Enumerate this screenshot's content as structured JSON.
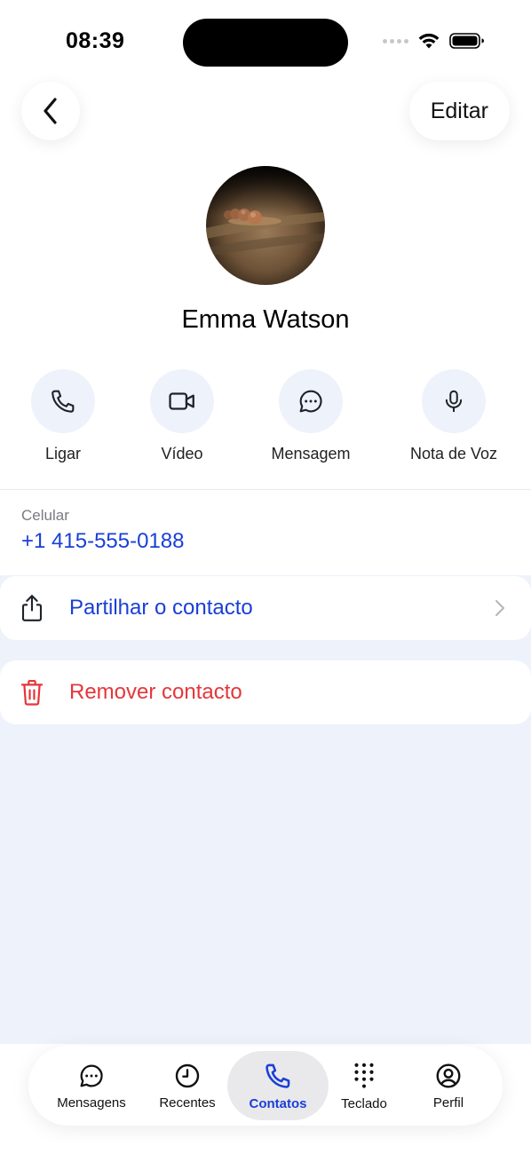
{
  "status_bar": {
    "time": "08:39"
  },
  "header": {
    "back_icon": "chevron-left-icon",
    "edit_label": "Editar"
  },
  "contact": {
    "name": "Emma Watson"
  },
  "actions": [
    {
      "icon": "phone-icon",
      "label": "Ligar"
    },
    {
      "icon": "video-icon",
      "label": "Vídeo"
    },
    {
      "icon": "message-icon",
      "label": "Mensagem"
    },
    {
      "icon": "microphone-icon",
      "label": "Nota de Voz"
    }
  ],
  "phone": {
    "label": "Celular",
    "value": "+1 415-555-0188"
  },
  "share": {
    "icon": "share-icon",
    "label": "Partilhar o contacto"
  },
  "remove": {
    "icon": "trash-icon",
    "label": "Remover contacto"
  },
  "tabbar": {
    "tabs": [
      {
        "icon": "chat-bubble-icon",
        "label": "Mensagens"
      },
      {
        "icon": "clock-icon",
        "label": "Recentes"
      },
      {
        "icon": "phone-icon",
        "label": "Contatos",
        "active": true
      },
      {
        "icon": "keypad-icon",
        "label": "Teclado"
      },
      {
        "icon": "profile-icon",
        "label": "Perfil"
      }
    ]
  },
  "colors": {
    "accent": "#1a3fd6",
    "danger": "#e5363a",
    "action_bg": "#eef2fb",
    "page_bg": "#eef2fb"
  }
}
